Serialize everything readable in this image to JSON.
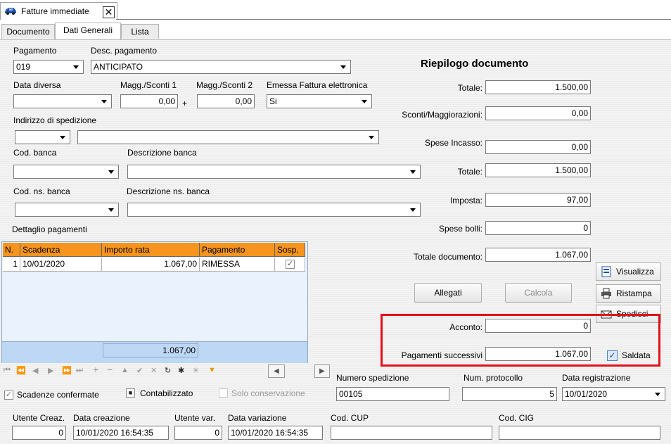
{
  "window": {
    "tab_title": "Fatture immediate",
    "close_glyph": "✕"
  },
  "tabs": [
    {
      "label": "Documento",
      "active": false
    },
    {
      "label": "Dati Generali",
      "active": true
    },
    {
      "label": "Lista",
      "active": false
    }
  ],
  "pagamento": {
    "label": "Pagamento",
    "value": "019",
    "desc_label": "Desc. pagamento",
    "desc_value": "ANTICIPATO"
  },
  "data_diversa": {
    "label": "Data diversa",
    "value": ""
  },
  "magg1": {
    "label": "Magg./Sconti 1",
    "value": "0,00"
  },
  "plus": "+",
  "magg2": {
    "label": "Magg./Sconti 2",
    "value": "0,00"
  },
  "fattura_elettronica": {
    "label": "Emessa Fattura elettronica",
    "value": "Si"
  },
  "indirizzo": {
    "label": "Indirizzo di spedizione"
  },
  "banca": {
    "cod_label": "Cod. banca",
    "desc_label": "Descrizione banca"
  },
  "ns_banca": {
    "cod_label": "Cod. ns. banca",
    "desc_label": "Descrizione ns. banca"
  },
  "dettaglio_label": "Dettaglio pagamenti",
  "grid": {
    "headers": [
      "N.",
      "Scadenza",
      "Importo rata",
      "Pagamento",
      "Sosp."
    ],
    "rows": [
      {
        "n": "1",
        "scadenza": "10/01/2020",
        "importo": "1.067,00",
        "pagamento": "RIMESSA",
        "sosp": "✓"
      }
    ],
    "total": "1.067,00"
  },
  "riepilogo": {
    "title": "Riepilogo documento",
    "totale_label": "Totale:",
    "totale": "1.500,00",
    "sconti_label": "Sconti/Maggiorazioni:",
    "sconti": "0,00",
    "spese_incasso_label": "Spese Incasso:",
    "spese_incasso": "0,00",
    "totale2_label": "Totale:",
    "totale2": "1.500,00",
    "imposta_label": "Imposta:",
    "imposta": "97,00",
    "spese_bolli_label": "Spese bolli:",
    "spese_bolli": "0",
    "totale_doc_label": "Totale documento:",
    "totale_doc": "1.067,00"
  },
  "buttons": {
    "allegati": "Allegati",
    "calcola": "Calcola",
    "visualizza": "Visualizza",
    "ristampa": "Ristampa",
    "spedisci": "Spedisci"
  },
  "acconto": {
    "label": "Acconto:",
    "value": "0"
  },
  "pagamenti_successivi": {
    "label": "Pagamenti successivi",
    "value": "1.067,00"
  },
  "saldata": {
    "label": "Saldata",
    "checked": true
  },
  "scadenze_confermate": "Scadenze confermate",
  "contabilizzato": "Contabilizzato",
  "solo_conservazione": "Solo conservazione",
  "numero_spedizione": {
    "label": "Numero spedizione",
    "value": "00105"
  },
  "num_protocollo": {
    "label": "Num. protocollo",
    "value": "5"
  },
  "data_registrazione": {
    "label": "Data registrazione",
    "value": "10/01/2020"
  },
  "utente_creaz": {
    "label": "Utente Creaz.",
    "value": "0"
  },
  "data_creazione": {
    "label": "Data creazione",
    "value": "10/01/2020 16:54:35"
  },
  "utente_var": {
    "label": "Utente var.",
    "value": "0"
  },
  "data_variazione": {
    "label": "Data variazione",
    "value": "10/01/2020 16:54:35"
  },
  "cod_cup": {
    "label": "Cod. CUP",
    "value": ""
  },
  "cod_cig": {
    "label": "Cod. CIG",
    "value": ""
  }
}
